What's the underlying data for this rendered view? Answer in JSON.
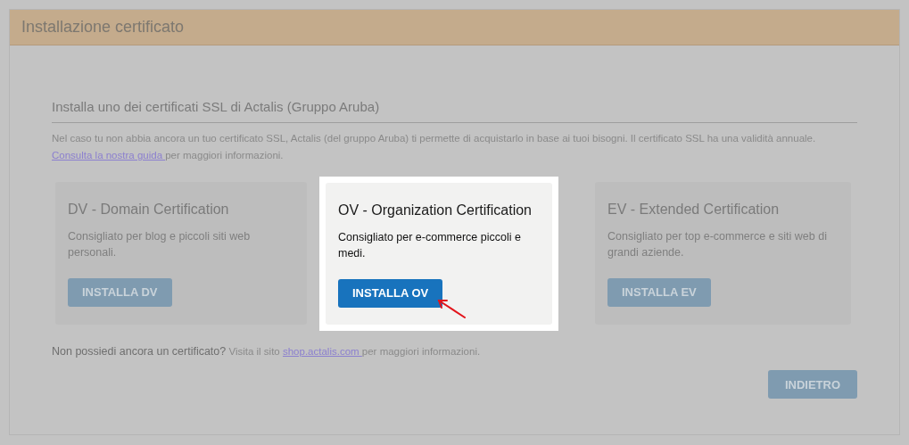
{
  "header": {
    "title": "Installazione certificato"
  },
  "section": {
    "heading": "Installa uno dei certificati SSL di Actalis (Gruppo Aruba)",
    "intro": "Nel caso tu non abbia ancora un tuo certificato SSL, Actalis (del gruppo Aruba) ti permette di acquistarlo in base ai tuoi bisogni. Il certificato SSL ha una validità annuale.",
    "guide_link": "Consulta la nostra guida ",
    "guide_rest": "per maggiori informazioni."
  },
  "cards": [
    {
      "title": "DV - Domain Certification",
      "description": "Consigliato per blog e piccoli siti web personali.",
      "button": "INSTALLA DV",
      "highlighted": false
    },
    {
      "title": "OV - Organization Certification",
      "description": "Consigliato per e-commerce piccoli e medi.",
      "button": "INSTALLA OV",
      "highlighted": true
    },
    {
      "title": "EV - Extended Certification",
      "description": "Consigliato per top e-commerce e siti web di grandi aziende.",
      "button": "INSTALLA EV",
      "highlighted": false
    }
  ],
  "footer": {
    "lead": "Non possiedi ancora un certificato?",
    "text": " Visita il sito ",
    "link": "shop.actalis.com ",
    "rest": "per maggiori informazioni."
  },
  "back_button": "INDIETRO"
}
